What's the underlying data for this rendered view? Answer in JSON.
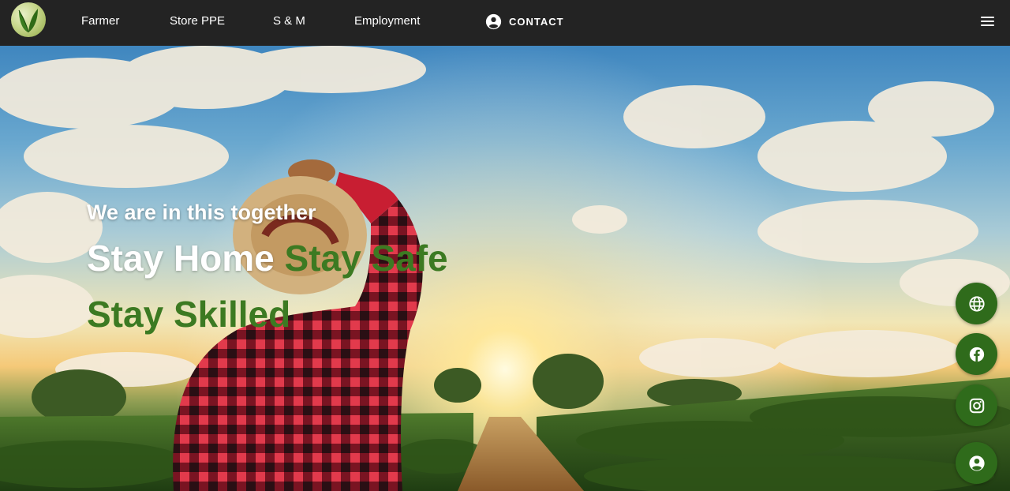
{
  "nav": {
    "links": [
      "Farmer",
      "Store PPE",
      "S & M",
      "Employment"
    ],
    "contact_label": "CONTACT",
    "logo_icon": "leaf-logo-icon",
    "menu_icon": "hamburger-menu-icon"
  },
  "hero": {
    "tagline": "We are in this together",
    "headline_1a": "Stay Home ",
    "headline_1b": "Stay Safe",
    "headline_2": "Stay Skilled"
  },
  "social": {
    "buttons": [
      "globe-icon",
      "facebook-icon",
      "instagram-icon",
      "account-icon"
    ]
  },
  "colors": {
    "navbar": "#232323",
    "accent_green": "#3c7a22",
    "fab_green": "#2f6b1b",
    "text_white": "#ffffff"
  }
}
